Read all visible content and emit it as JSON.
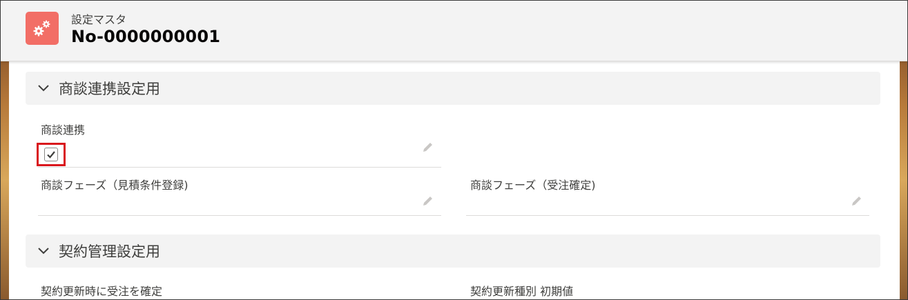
{
  "header": {
    "object_label": "設定マスタ",
    "record_name": "No-0000000001",
    "icon": "settings-gears-icon",
    "icon_color": "#f26e66"
  },
  "sections": [
    {
      "title": "商談連携設定用",
      "fields": [
        {
          "label": "商談連携",
          "type": "checkbox",
          "checked": true
        },
        {
          "label": "商談フェーズ（見積条件登録)",
          "value": ""
        },
        {
          "label": "商談フェーズ（受注確定)",
          "value": ""
        }
      ]
    },
    {
      "title": "契約管理設定用",
      "fields": [
        {
          "label": "契約更新時に受注を確定"
        },
        {
          "label": "契約更新種別 初期値"
        }
      ]
    }
  ],
  "colors": {
    "highlight": "#d9161c",
    "section_bg": "#f3f3f3"
  }
}
